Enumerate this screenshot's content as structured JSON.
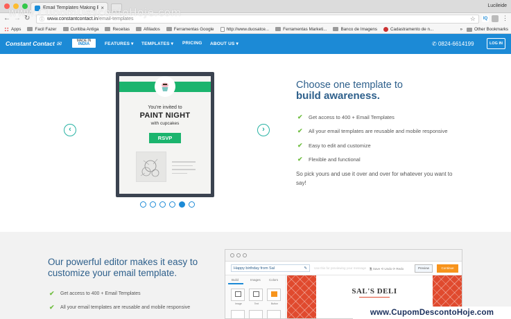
{
  "browser": {
    "tab_title": "Email Templates Making Emai",
    "user_name": "Lucileide",
    "url_host": "www.constantcontact.in",
    "url_path": "/email-templates",
    "overlay_watermark": "www.CupomDescontoHoje.com",
    "bookmarks": [
      "Apps",
      "Facil Fazer",
      "Curitiba Antiga",
      "Receitas",
      "Afiliados",
      "Ferramentas Google",
      "http://www.duosatce...",
      "Ferramentas Marketi...",
      "Banco de Imagens",
      "Cadastramento de n..."
    ],
    "other_bookmarks": "Other Bookmarks",
    "more": "»",
    "ext_iq": "IQ"
  },
  "site_header": {
    "logo": "Constant Contact",
    "badge_top": "MADE IN",
    "badge_country": "INDIA",
    "menu": [
      "FEATURES ▾",
      "TEMPLATES ▾",
      "PRICING",
      "ABOUT US ▾"
    ],
    "phone": "0824-6614199",
    "login": "LOG IN"
  },
  "hero": {
    "title_line1": "Choose one template to",
    "title_line2": "build awareness.",
    "features": [
      "Get access to 400 + Email Templates",
      "All your email templates are reusable and mobile responsive",
      "Easy to edit and customize",
      "Flexible and functional"
    ],
    "pick_text": "So pick yours and use it over and over for whatever you want to say!",
    "template": {
      "invited": "You're invited to",
      "event": "PAINT NIGHT",
      "with": "with cupcakes",
      "button": "RSVP"
    },
    "carousel_active_index": 4,
    "carousel_count": 6
  },
  "editor_section": {
    "title": "Our powerful editor makes it easy to customize your email template.",
    "features": [
      "Get access to 400 + Email Templates",
      "All your email templates are reusable and mobile responsive"
    ],
    "subject": "Happy birthday from Sal",
    "ghost_text": "Use this for previewing your message",
    "tools": "🗎 Save  ⟲ Undo  ⟳ Redo",
    "preview": "Preview",
    "continue": "Continue",
    "side_tabs": [
      "Build",
      "Images",
      "Colors"
    ],
    "blocks": [
      "Image",
      "Text",
      "Button"
    ],
    "deli": "SAL'S DELI"
  },
  "footer_watermark": "www.CupomDescontoHoje.com",
  "colors": {
    "brand_blue": "#1c8ad6",
    "green": "#1bb46e",
    "check": "#72bf44",
    "title_blue": "#2d5f8b"
  }
}
